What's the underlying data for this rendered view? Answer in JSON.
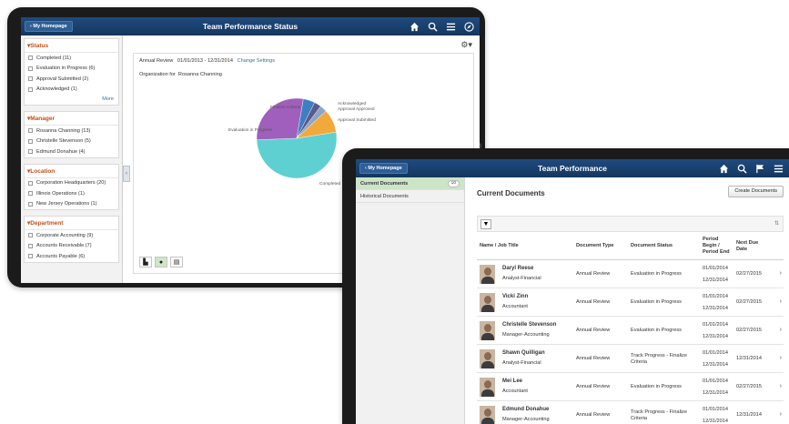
{
  "colors": {
    "header": "#1f4b7e",
    "accent_orange": "#c0501a",
    "active_nav": "#cde5c7",
    "link": "#3a6ea8"
  },
  "screen1": {
    "home_label": "My Homepage",
    "title": "Team Performance Status",
    "header_icons": [
      "home-icon",
      "search-icon",
      "menu-icon",
      "compass-icon"
    ],
    "filters": [
      {
        "heading": "Status",
        "items": [
          "Completed (11)",
          "Evaluation in Progress (6)",
          "Approval Submitted (2)",
          "Acknowledged (1)"
        ],
        "more": "More"
      },
      {
        "heading": "Manager",
        "items": [
          "Rosanna Channing (13)",
          "Christelle Stevenson (5)",
          "Edmund Donahue (4)"
        ]
      },
      {
        "heading": "Location",
        "items": [
          "Corporation Headquarters (20)",
          "Illinois Operations (1)",
          "New Jersey Operations (1)"
        ]
      },
      {
        "heading": "Department",
        "items": [
          "Corporate Accounting (9)",
          "Accounts Receivable (7)",
          "Accounts Payable (6)"
        ]
      }
    ],
    "review_type": "Annual Review",
    "review_period": "01/01/2013 - 12/31/2014",
    "change_settings": "Change Settings",
    "org_label": "Organization for",
    "org_name": "Rosanna Channing"
  },
  "chart_data": {
    "type": "pie",
    "slices": [
      {
        "label": "Completed",
        "value": 11,
        "color": "#5ed0d2"
      },
      {
        "label": "Evaluation in Progress",
        "value": 6,
        "color": "#a05fbc"
      },
      {
        "label": "Finalize Criteria",
        "value": 1,
        "color": "#3d7fc2"
      },
      {
        "label": "Acknowledged",
        "value": 0.6,
        "color": "#5a5a8c"
      },
      {
        "label": "Approval Approved",
        "value": 0.6,
        "color": "#8aa5c8"
      },
      {
        "label": "Approval Submitted",
        "value": 2,
        "color": "#f2a93b"
      }
    ]
  },
  "screen2": {
    "home_label": "My Homepage",
    "title": "Team Performance",
    "header_icons": [
      "home-icon",
      "search-icon",
      "flag-icon",
      "menu-icon"
    ],
    "nav": [
      {
        "label": "Current Documents",
        "count": "10"
      },
      {
        "label": "Historical Documents"
      }
    ],
    "page_title": "Current Documents",
    "create_button": "Create Documents",
    "columns": [
      "Name / Job Title",
      "Document Type",
      "Document Status",
      "Period Begin / Period End",
      "Next Due Date"
    ],
    "rows": [
      {
        "name": "Daryl Reese",
        "job": "Analyst-Financial",
        "type": "Annual Review",
        "status": "Evaluation in Progress",
        "begin": "01/01/2014",
        "end": "12/31/2014",
        "due": "02/27/2015"
      },
      {
        "name": "Vicki Zinn",
        "job": "Accountant",
        "type": "Annual Review",
        "status": "Evaluation in Progress",
        "begin": "01/01/2014",
        "end": "12/31/2014",
        "due": "02/27/2015"
      },
      {
        "name": "Christelle Stevenson",
        "job": "Manager-Accounting",
        "type": "Annual Review",
        "status": "Evaluation in Progress",
        "begin": "01/01/2014",
        "end": "12/31/2014",
        "due": "02/27/2015"
      },
      {
        "name": "Shawn Quilligan",
        "job": "Analyst-Financial",
        "type": "Annual Review",
        "status": "Track Progress - Finalize Criteria",
        "begin": "01/01/2014",
        "end": "12/31/2014",
        "due": "12/31/2014"
      },
      {
        "name": "Mei Lee",
        "job": "Accountant",
        "type": "Annual Review",
        "status": "Evaluation in Progress",
        "begin": "01/01/2014",
        "end": "12/31/2014",
        "due": "02/27/2015"
      },
      {
        "name": "Edmund Donahue",
        "job": "Manager-Accounting",
        "type": "Annual Review",
        "status": "Track Progress - Finalize Criteria",
        "begin": "01/01/2014",
        "end": "12/31/2014",
        "due": "12/31/2014"
      }
    ]
  }
}
